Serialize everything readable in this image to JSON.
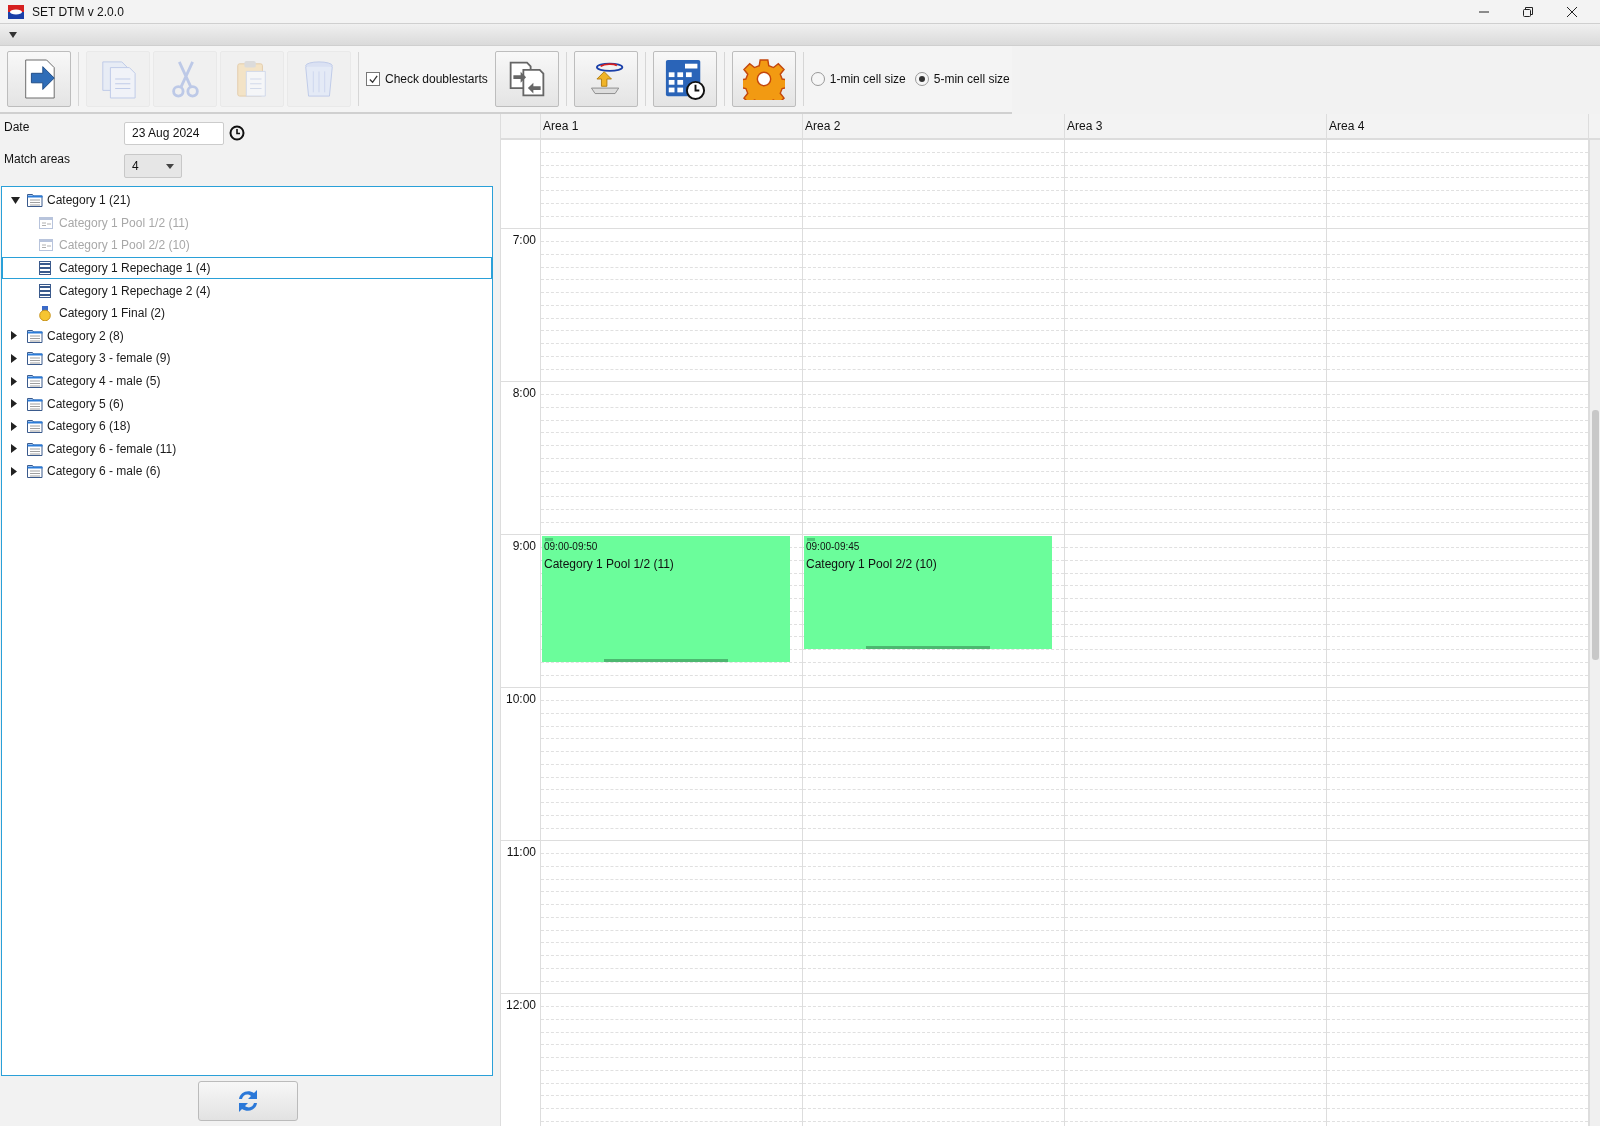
{
  "window": {
    "title": "SET DTM v 2.0.0"
  },
  "toolbar": {
    "buttons": [
      {
        "kind": "export",
        "disabled": false
      },
      {
        "kind": "copy",
        "disabled": true
      },
      {
        "kind": "cut",
        "disabled": true
      },
      {
        "kind": "paste",
        "disabled": true
      },
      {
        "kind": "delete",
        "disabled": true
      }
    ],
    "check_doublestarts": {
      "label": "Check doublestarts",
      "checked": true
    },
    "buttons_2": [
      {
        "kind": "swap",
        "disabled": false
      },
      {
        "kind": "import",
        "disabled": false
      },
      {
        "kind": "timetable",
        "disabled": false
      },
      {
        "kind": "settings",
        "disabled": false
      }
    ],
    "cell_size": [
      {
        "label": "1-min cell size",
        "selected": false
      },
      {
        "label": "5-min cell size",
        "selected": true
      }
    ]
  },
  "date": {
    "label": "Date",
    "value": "23 Aug 2024"
  },
  "match_areas": {
    "label": "Match areas",
    "value": "4"
  },
  "tree": [
    {
      "label": "Category 1 (21)",
      "kind": "category",
      "expanded": true,
      "selected": false,
      "children": [
        {
          "label": "Category 1 Pool 1/2 (11)",
          "kind": "pool",
          "disabled": true,
          "selected": false
        },
        {
          "label": "Category 1 Pool 2/2 (10)",
          "kind": "pool",
          "disabled": true,
          "selected": false
        },
        {
          "label": "Category 1 Repechage 1 (4)",
          "kind": "repechage",
          "disabled": false,
          "selected": true
        },
        {
          "label": "Category 1 Repechage 2 (4)",
          "kind": "repechage",
          "disabled": false,
          "selected": false
        },
        {
          "label": "Category 1 Final (2)",
          "kind": "final",
          "disabled": false,
          "selected": false
        }
      ]
    },
    {
      "label": "Category 2 (8)",
      "kind": "category",
      "expanded": false,
      "selected": false
    },
    {
      "label": "Category 3 - female (9)",
      "kind": "category",
      "expanded": false,
      "selected": false
    },
    {
      "label": "Category 4 - male (5)",
      "kind": "category",
      "expanded": false,
      "selected": false
    },
    {
      "label": "Category 5 (6)",
      "kind": "category",
      "expanded": false,
      "selected": false
    },
    {
      "label": "Category 6 (18)",
      "kind": "category",
      "expanded": false,
      "selected": false
    },
    {
      "label": "Category 6 - female (11)",
      "kind": "category",
      "expanded": false,
      "selected": false
    },
    {
      "label": "Category 6 - male (6)",
      "kind": "category",
      "expanded": false,
      "selected": false
    }
  ],
  "schedule": {
    "hours": [
      "7:00",
      "8:00",
      "9:00",
      "10:00",
      "11:00",
      "12:00"
    ],
    "areas": [
      {
        "label": "Area 1",
        "events": [
          {
            "time": "09:00-09:50",
            "title": "Category 1 Pool 1/2 (11)"
          }
        ]
      },
      {
        "label": "Area 2",
        "events": [
          {
            "time": "09:00-09:45",
            "title": "Category 1 Pool 2/2 (10)"
          }
        ]
      },
      {
        "label": "Area 3"
      },
      {
        "label": "Area 4"
      }
    ]
  }
}
